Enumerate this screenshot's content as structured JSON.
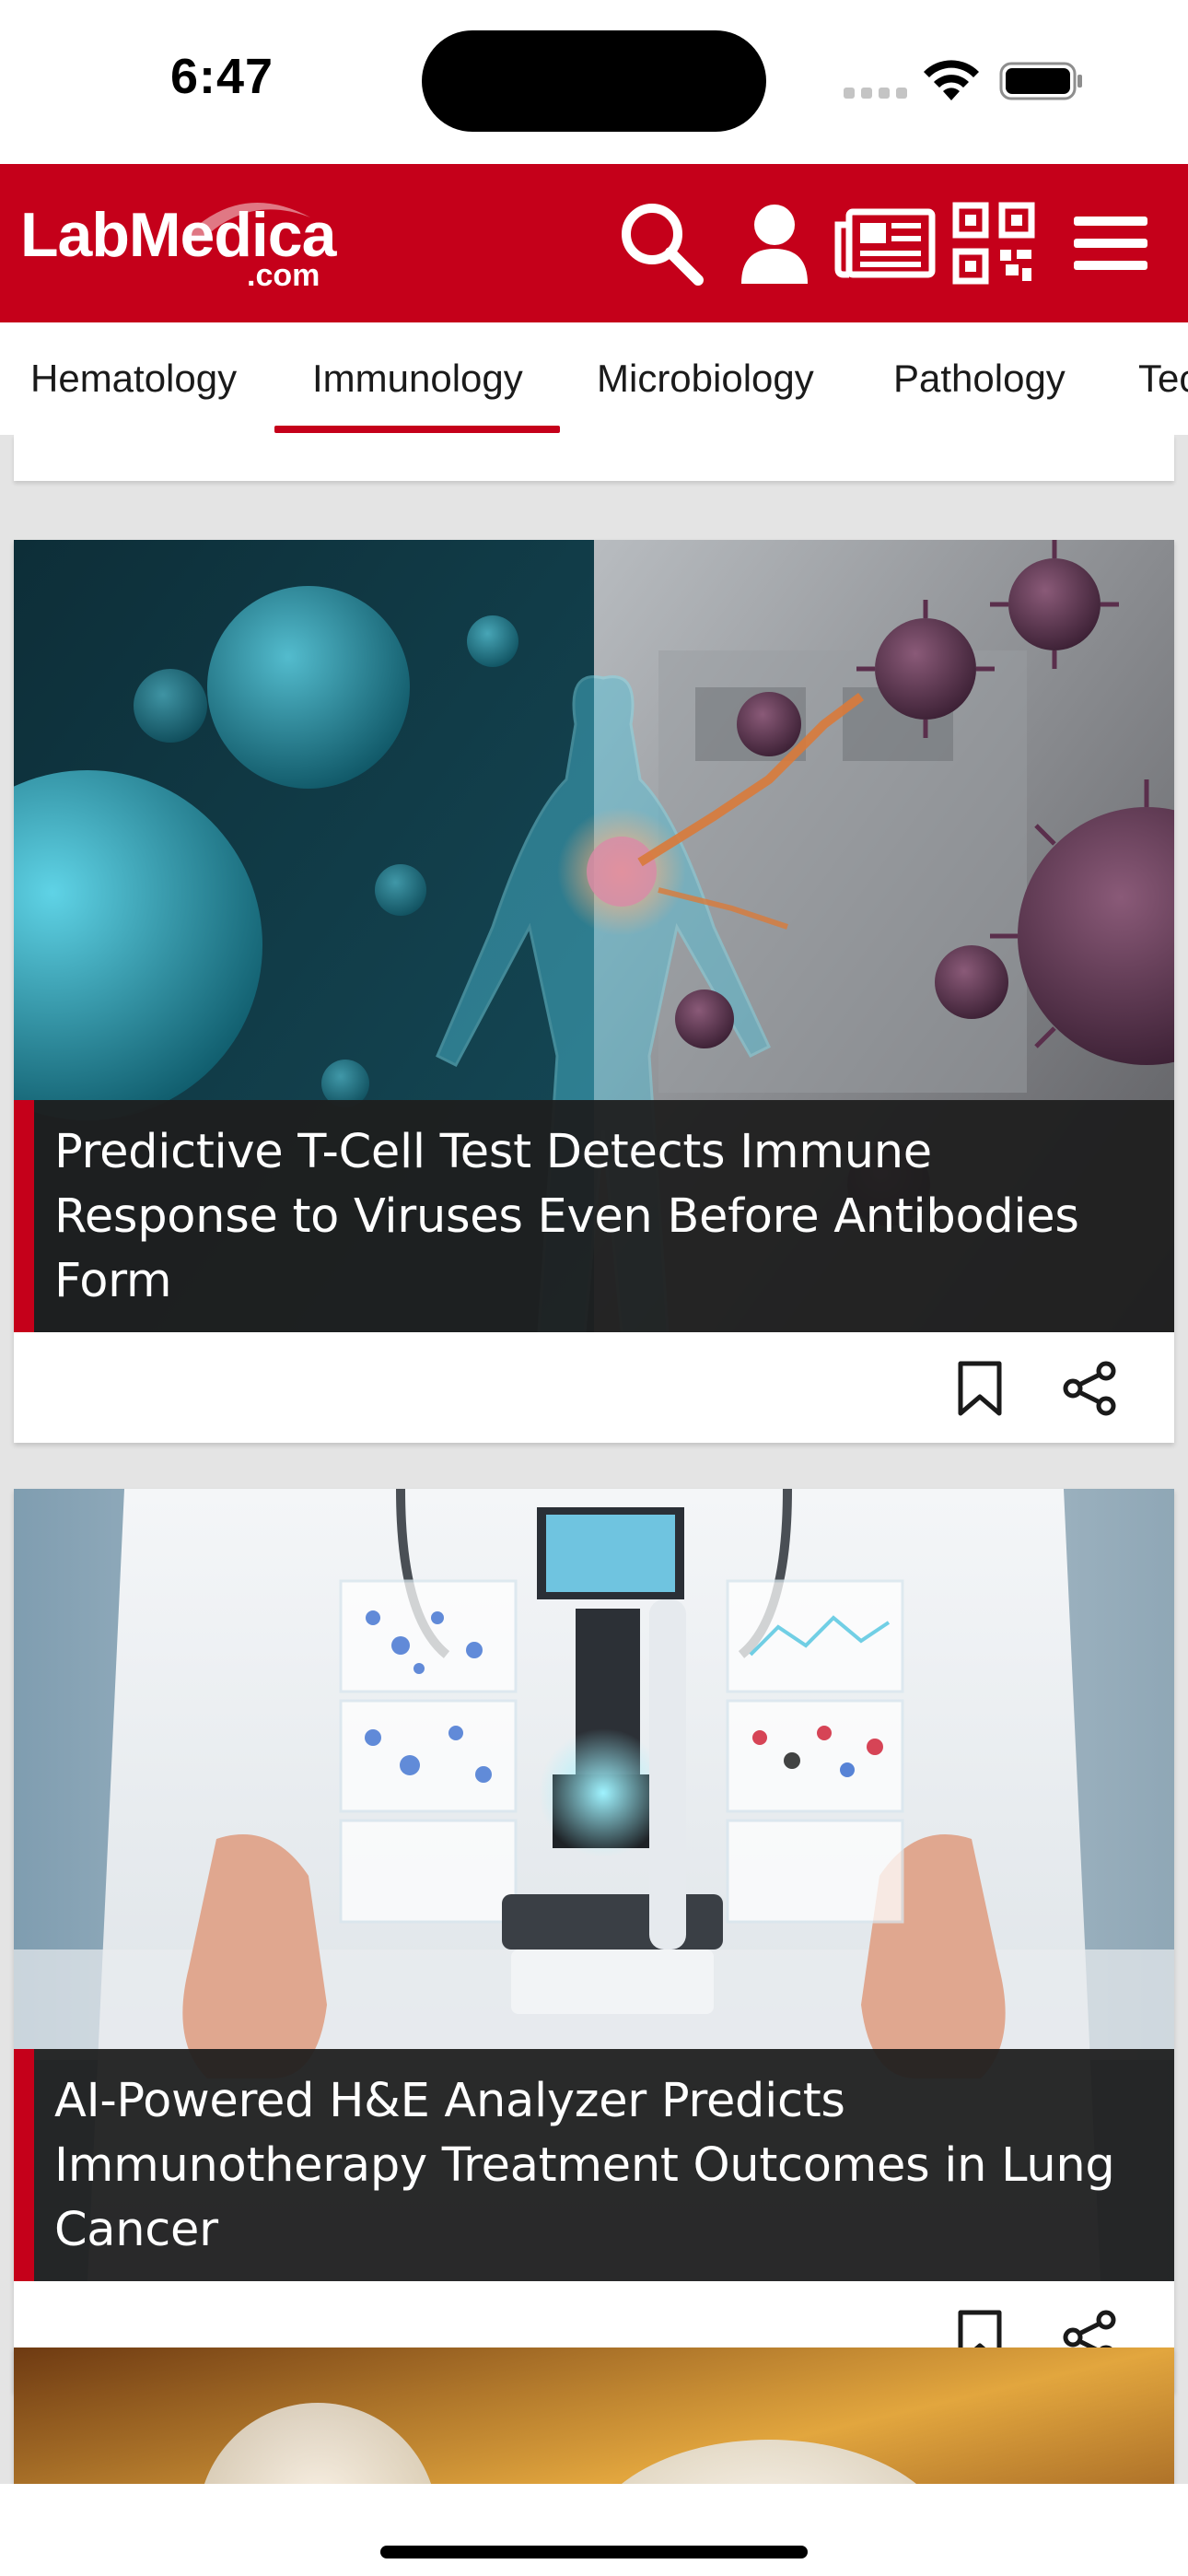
{
  "status_bar": {
    "time": "6:47"
  },
  "header": {
    "logo_main": "LabMedica",
    "logo_sub": ".com",
    "brand_color": "#c5001a",
    "icons": [
      "search-icon",
      "user-icon",
      "newspaper-icon",
      "qr-code-icon",
      "hamburger-menu-icon"
    ]
  },
  "tabs": [
    {
      "label": "Hematology",
      "selected": false
    },
    {
      "label": "Immunology",
      "selected": true
    },
    {
      "label": "Microbiology",
      "selected": false
    },
    {
      "label": "Pathology",
      "selected": false
    },
    {
      "label": "Tec",
      "selected": false
    }
  ],
  "articles": [
    {
      "title": "Predictive T-Cell Test Detects Immune Response to Viruses Even Before Antibodies Form",
      "image": "illustration of a human figure among viruses and cells"
    },
    {
      "title": "AI-Powered H&E Analyzer Predicts Immunotherapy Treatment Outcomes in Lung Cancer",
      "image": "doctor holding a microscope with holographic panels"
    }
  ]
}
